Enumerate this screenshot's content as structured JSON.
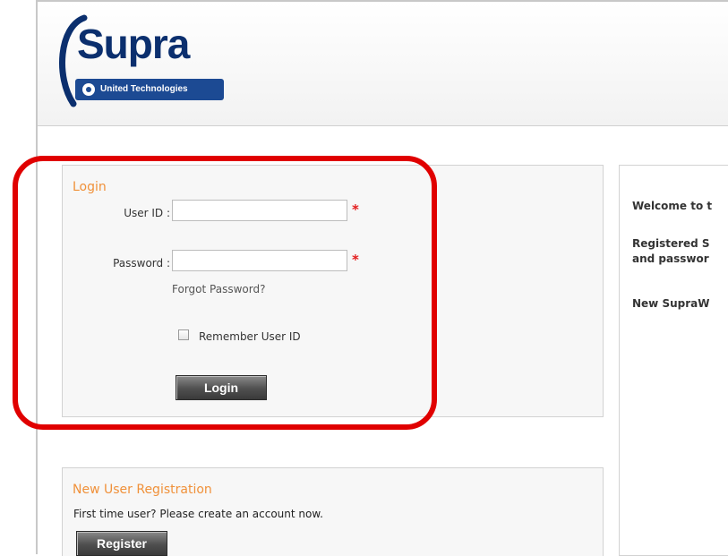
{
  "brand": {
    "logo_word": "Supra",
    "logo_sub": "United Technologies"
  },
  "login": {
    "title": "Login",
    "user_id_label": "User ID :",
    "password_label": "Password :",
    "required_mark": "*",
    "forgot_password": "Forgot Password?",
    "remember_label": "Remember User ID",
    "login_button": "Login"
  },
  "welcome": {
    "line1": "Welcome to t",
    "line2a": "Registered S",
    "line2b": "and passwor",
    "line3": "New SupraW"
  },
  "registration": {
    "title": "New User Registration",
    "description": "First time user? Please create an account now.",
    "register_button": "Register"
  },
  "colors": {
    "accent_orange": "#f0913a",
    "highlight_red": "#e00000",
    "logo_blue": "#0b2f6e"
  }
}
